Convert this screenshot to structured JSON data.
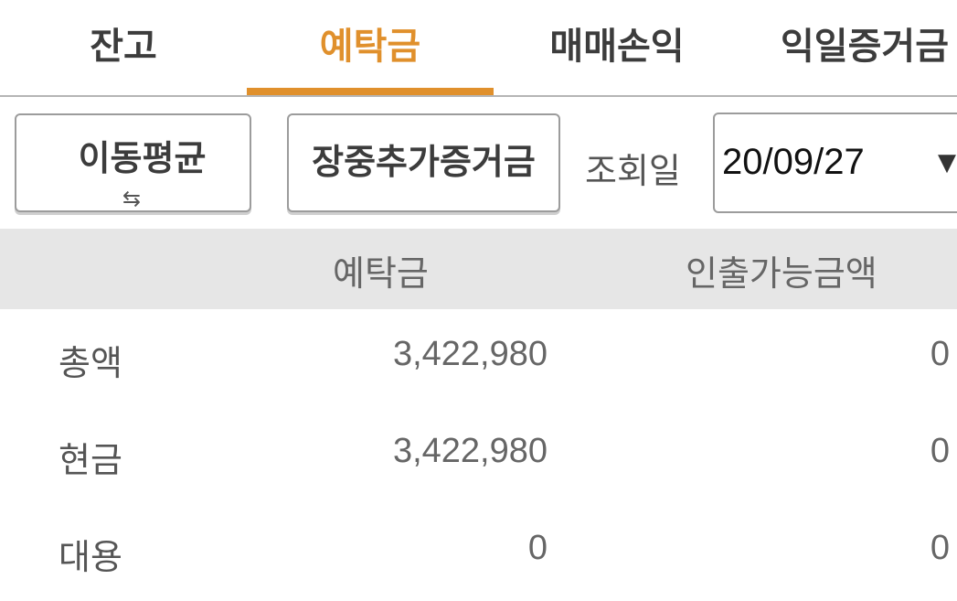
{
  "tabs": [
    {
      "label": "잔고",
      "active": false
    },
    {
      "label": "예탁금",
      "active": true
    },
    {
      "label": "매매손익",
      "active": false
    },
    {
      "label": "익일증거금",
      "active": false
    }
  ],
  "accent_color": "#e0902c",
  "toolbar": {
    "moving_average_label": "이동평균",
    "swap_icon": "swap-arrows-icon",
    "extra_margin_label": "장중추가증거금",
    "query_date_label": "조회일",
    "query_date_value": "20/09/27",
    "dropdown_icon": "triangle-down-icon"
  },
  "table": {
    "headers": [
      "예탁금",
      "인출가능금액"
    ],
    "rows": [
      {
        "label": "총액",
        "deposit": "3,422,980",
        "withdrawable": "0"
      },
      {
        "label": "현금",
        "deposit": "3,422,980",
        "withdrawable": "0"
      },
      {
        "label": "대용",
        "deposit": "0",
        "withdrawable": "0"
      }
    ]
  }
}
